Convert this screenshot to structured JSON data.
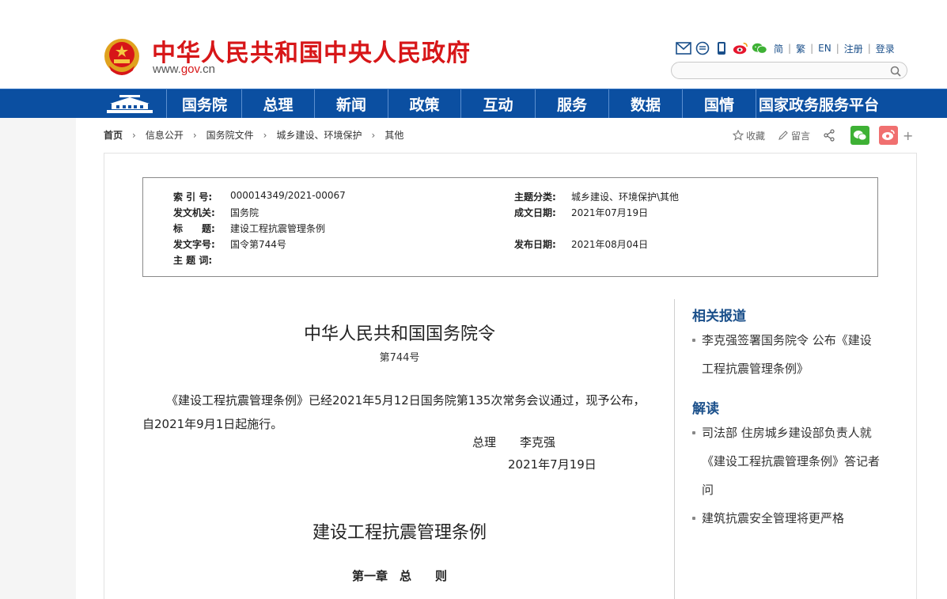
{
  "header": {
    "site_title": "中华人民共和国中央人民政府",
    "url_www": "www.",
    "url_gov": "gov",
    "url_cn": ".cn",
    "lang": {
      "simplified": "简",
      "traditional": "繁",
      "english": "EN",
      "register": "注册",
      "login": "登录"
    },
    "search_placeholder": ""
  },
  "nav": {
    "items": [
      {
        "label": "国务院",
        "width": 94
      },
      {
        "label": "总理",
        "width": 92
      },
      {
        "label": "新闻",
        "width": 93
      },
      {
        "label": "政策",
        "width": 92
      },
      {
        "label": "互动",
        "width": 94
      },
      {
        "label": "服务",
        "width": 93
      },
      {
        "label": "数据",
        "width": 93
      },
      {
        "label": "国情",
        "width": 93
      },
      {
        "label": "国家政务服务平台",
        "width": 158
      }
    ]
  },
  "breadcrumb": [
    "首页",
    "信息公开",
    "国务院文件",
    "城乡建设、环境保护",
    "其他"
  ],
  "share": {
    "favorite": "收藏",
    "comment": "留言",
    "plus": "+"
  },
  "meta": {
    "index_label": "索 引 号:",
    "index_value": "000014349/2021-00067",
    "topic_label": "主题分类:",
    "topic_value": "城乡建设、环境保护\\其他",
    "issuer_label": "发文机关:",
    "issuer_value": "国务院",
    "created_label": "成文日期:",
    "created_value": "2021年07月19日",
    "title_label": "标　　题:",
    "title_value": "建设工程抗震管理条例",
    "docno_label": "发文字号:",
    "docno_value": "国令第744号",
    "published_label": "发布日期:",
    "published_value": "2021年08月04日",
    "keywords_label": "主 题 词:",
    "keywords_value": ""
  },
  "article": {
    "order_title": "中华人民共和国国务院令",
    "order_no": "第744号",
    "paragraph": "《建设工程抗震管理条例》已经2021年5月12日国务院第135次常务会议通过，现予公布，自2021年9月1日起施行。",
    "sign_name": "总理　　李克强",
    "sign_date": "2021年7月19日",
    "law_title": "建设工程抗震管理条例",
    "chapter": "第一章　总　　则"
  },
  "sidebar": {
    "related_title": "相关报道",
    "related": [
      "李克强签署国务院令 公布《建设工程抗震管理条例》"
    ],
    "interpret_title": "解读",
    "interpret": [
      "司法部 住房城乡建设部负责人就《建设工程抗震管理条例》答记者问",
      "建筑抗震安全管理将更严格"
    ]
  },
  "colors": {
    "brand_red": "#d71618",
    "nav_blue": "#0b4fa1",
    "link_blue": "#1a4f8a"
  }
}
